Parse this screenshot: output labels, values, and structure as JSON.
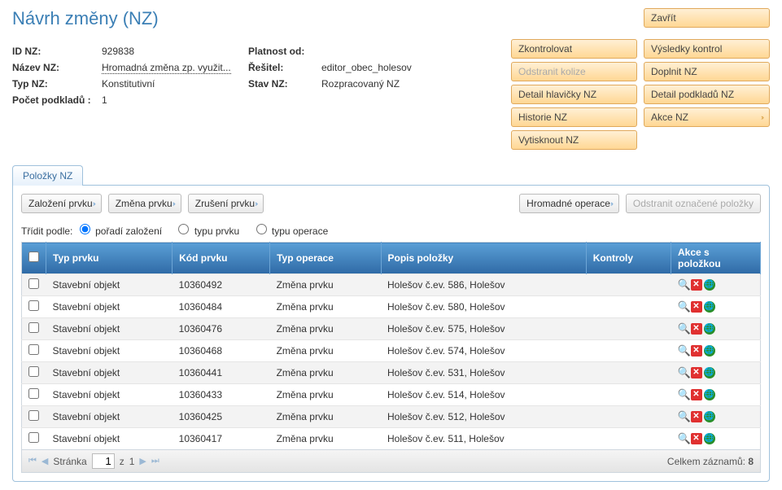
{
  "title": "Návrh změny (NZ)",
  "info": {
    "id_label": "ID NZ:",
    "id_value": "929838",
    "name_label": "Název NZ:",
    "name_value": "Hromadná změna zp. využit...",
    "type_label": "Typ NZ:",
    "type_value": "Konstitutivní",
    "docs_label": "Počet podkladů :",
    "docs_value": "1",
    "valid_label": "Platnost od:",
    "valid_value": "",
    "solver_label": "Řešitel:",
    "solver_value": "editor_obec_holesov",
    "state_label": "Stav NZ:",
    "state_value": "Rozpracovaný NZ"
  },
  "buttons": {
    "close": "Zavřít",
    "check": "Zkontrolovat",
    "results": "Výsledky kontrol",
    "remove_collisions": "Odstranit kolize",
    "supplement": "Doplnit NZ",
    "header_detail": "Detail hlavičky NZ",
    "docs_detail": "Detail podkladů NZ",
    "history": "Historie NZ",
    "actions": "Akce NZ",
    "print": "Vytisknout NZ"
  },
  "tab": "Položky NZ",
  "toolbar": {
    "create": "Založení prvku",
    "change": "Změna prvku",
    "cancel": "Zrušení prvku",
    "bulk": "Hromadné operace",
    "remove_selected": "Odstranit označené položky"
  },
  "sort": {
    "label": "Třídit podle:",
    "opt_order": "pořadí založení",
    "opt_type": "typu prvku",
    "opt_op": "typu operace"
  },
  "columns": {
    "type": "Typ prvku",
    "code": "Kód prvku",
    "op": "Typ operace",
    "desc": "Popis položky",
    "checks": "Kontroly",
    "actions": "Akce s položkou"
  },
  "rows": [
    {
      "type": "Stavební objekt",
      "code": "10360492",
      "op": "Změna prvku",
      "desc": "Holešov č.ev. 586, Holešov"
    },
    {
      "type": "Stavební objekt",
      "code": "10360484",
      "op": "Změna prvku",
      "desc": "Holešov č.ev. 580, Holešov"
    },
    {
      "type": "Stavební objekt",
      "code": "10360476",
      "op": "Změna prvku",
      "desc": "Holešov č.ev. 575, Holešov"
    },
    {
      "type": "Stavební objekt",
      "code": "10360468",
      "op": "Změna prvku",
      "desc": "Holešov č.ev. 574, Holešov"
    },
    {
      "type": "Stavební objekt",
      "code": "10360441",
      "op": "Změna prvku",
      "desc": "Holešov č.ev. 531, Holešov"
    },
    {
      "type": "Stavební objekt",
      "code": "10360433",
      "op": "Změna prvku",
      "desc": "Holešov č.ev. 514, Holešov"
    },
    {
      "type": "Stavební objekt",
      "code": "10360425",
      "op": "Změna prvku",
      "desc": "Holešov č.ev. 512, Holešov"
    },
    {
      "type": "Stavební objekt",
      "code": "10360417",
      "op": "Změna prvku",
      "desc": "Holešov č.ev. 511, Holešov"
    }
  ],
  "pager": {
    "page_label": "Stránka",
    "page": "1",
    "of_label": "z",
    "total_pages": "1",
    "total_label": "Celkem záznamů:",
    "total": "8"
  }
}
